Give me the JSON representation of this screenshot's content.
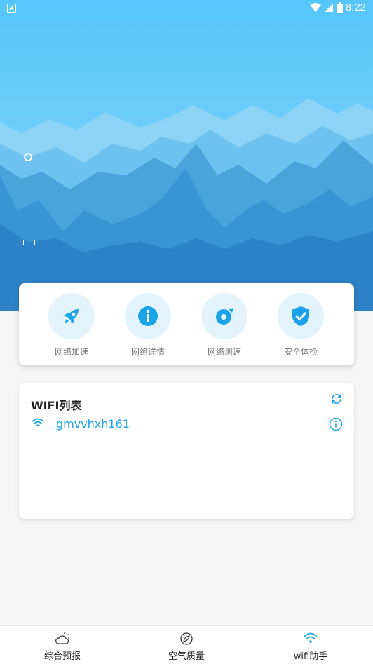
{
  "status_bar": {
    "time": "8:22",
    "notification_glyph": "A",
    "icons": [
      "wifi-icon",
      "signal-icon",
      "battery-icon"
    ]
  },
  "colors": {
    "accent": "#1aa3e8",
    "sky_top": "#55c6fb",
    "mountain_far": "#6ec2ef",
    "mountain_mid": "#4ba3db",
    "mountain_near": "#2d82c6",
    "icon_bg": "#e3f3fc"
  },
  "features": [
    {
      "label": "网络加速",
      "icon": "rocket-icon"
    },
    {
      "label": "网络详情",
      "icon": "info-icon"
    },
    {
      "label": "网络测速",
      "icon": "speed-icon"
    },
    {
      "label": "安全体检",
      "icon": "shield-check-icon"
    }
  ],
  "wifi_list": {
    "title": "WIFI列表",
    "networks": [
      {
        "ssid": "gmvvhxh161"
      }
    ]
  },
  "bottom_nav": [
    {
      "label": "综合预报",
      "icon": "weather-icon",
      "active": false
    },
    {
      "label": "空气质量",
      "icon": "leaf-icon",
      "active": false
    },
    {
      "label": "wifi助手",
      "icon": "wifi-icon",
      "active": true
    }
  ]
}
